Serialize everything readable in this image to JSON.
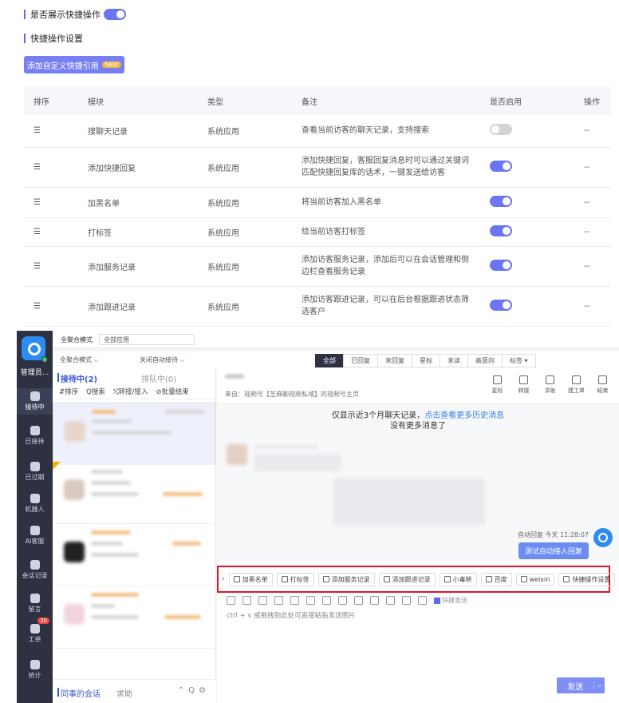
{
  "settings": {
    "show_quick_label": "是否展示快捷操作",
    "show_quick_on": true,
    "section_title": "快捷操作设置",
    "add_button_label": "添加自定义快捷引用",
    "add_button_tag": "NEW",
    "columns": [
      "排序",
      "模块",
      "类型",
      "备注",
      "是否启用",
      "操作"
    ],
    "rows": [
      {
        "module": "搜聊天记录",
        "type": "系统应用",
        "note": "查看当前访客的聊天记录，支持搜索",
        "enabled": false,
        "op": "--"
      },
      {
        "module": "添加快捷回复",
        "type": "系统应用",
        "note": "添加快捷回复，客服回复消息时可以通过关键词匹配快捷回复库的话术，一键发送给访客",
        "enabled": true,
        "op": "--"
      },
      {
        "module": "加黑名单",
        "type": "系统应用",
        "note": "将当前访客加入黑名单",
        "enabled": true,
        "op": "--"
      },
      {
        "module": "打标签",
        "type": "系统应用",
        "note": "给当前访客打标签",
        "enabled": true,
        "op": "--"
      },
      {
        "module": "添加服务记录",
        "type": "系统应用",
        "note": "添加访客服务记录，添加后可以在会话管理和侧边栏查看服务记录",
        "enabled": true,
        "op": "--"
      },
      {
        "module": "添加跟进记录",
        "type": "系统应用",
        "note": "添加访客跟进记录，可以在后台根据跟进状态筛选客户",
        "enabled": true,
        "op": "--"
      }
    ]
  },
  "chat": {
    "admin_label": "管理员...",
    "nav": [
      {
        "label": "接待中",
        "active": true
      },
      {
        "label": "已接待"
      },
      {
        "label": "已过期"
      },
      {
        "label": "机器人"
      },
      {
        "label": "AI客服"
      },
      {
        "label": "会话记录"
      },
      {
        "label": "留言"
      },
      {
        "label": "工单",
        "badge": "30"
      },
      {
        "label": "统计"
      }
    ],
    "topbar1": {
      "mode_label": "全聚合模式",
      "app_select": "全部应用"
    },
    "topbar2": {
      "mode_select": "全聚合模式",
      "auto_close": "关闭自动接待"
    },
    "filters": [
      "全部",
      "已回复",
      "未回复",
      "星标",
      "未读",
      "高意向",
      "标签 ▾"
    ],
    "list_tabs": {
      "active": "接待中(2)",
      "queue": "排队中(0)"
    },
    "list_actions": [
      "⇵排序",
      "Q搜索",
      "⤭转接/接入",
      "⊘批量结束"
    ],
    "bottom_tabs": {
      "colleague": "同事的会话",
      "help": "求助"
    },
    "source_text": "来自：视频号【芝麻聊视频私域】的视频号主页",
    "tools": [
      "星标",
      "转接",
      "求助",
      "建工单",
      "结束"
    ],
    "notice_prefix": "仅显示近3个月聊天记录，",
    "notice_link": "点击查看更多历史消息",
    "notice_more": "没有更多消息了",
    "auto_reply_label": "自动回复  今天 11:28:07",
    "auto_reply_text": "测试自动接入回复",
    "quick_actions": [
      "加黑名单",
      "打标签",
      "添加服务记录",
      "添加跟进记录",
      "小毒新",
      "百度",
      "weixin",
      "快捷操作设置"
    ],
    "quick_send_label": "快捷发送",
    "input_hint": "ctrl + v 或拖拽到此处可直接粘贴发送图片",
    "send_label": "发送"
  }
}
